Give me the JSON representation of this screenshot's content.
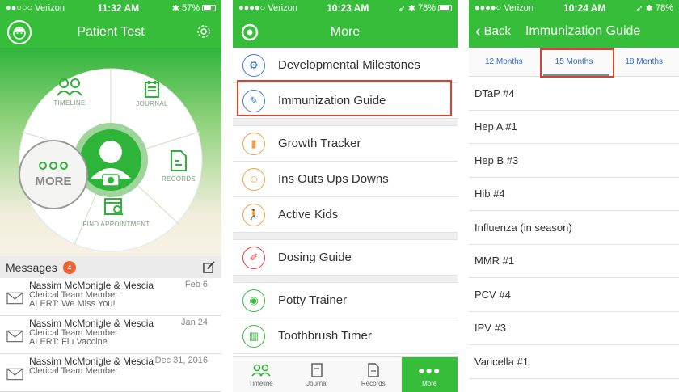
{
  "phone1": {
    "status": {
      "carrier": "●●○○○ Verizon",
      "time": "11:32 AM",
      "battery": "57%",
      "battery_level": 0.57
    },
    "title": "Patient Test",
    "wheel": {
      "timeline": "TIMELINE",
      "journal": "JOURNAL",
      "records": "RECORDS",
      "find_appointment": "FIND APPOINTMENT",
      "more": "MORE"
    },
    "messages": {
      "header": "Messages",
      "count": "4",
      "items": [
        {
          "from": "Nassim McMonigle & Mescia",
          "role": "Clerical Team Member",
          "subject": "ALERT: We Miss You!",
          "date": "Feb 6"
        },
        {
          "from": "Nassim McMonigle & Mescia",
          "role": "Clerical Team Member",
          "subject": "ALERT: Flu Vaccine",
          "date": "Jan 24"
        },
        {
          "from": "Nassim McMonigle & Mescia",
          "role": "Clerical Team Member",
          "subject": "",
          "date": "Dec 31, 2016"
        }
      ]
    }
  },
  "phone2": {
    "status": {
      "carrier": "●●●●○ Verizon",
      "time": "10:23 AM",
      "battery": "78%",
      "battery_level": 0.78
    },
    "title": "More",
    "menu": [
      {
        "label": "Developmental Milestones",
        "icon": "milestones-icon",
        "color": "#3a7fd5"
      },
      {
        "label": "Immunization Guide",
        "icon": "syringe-icon",
        "color": "#3a7fd5"
      },
      {
        "label": "Growth Tracker",
        "icon": "ruler-icon",
        "color": "#f0a146"
      },
      {
        "label": "Ins Outs Ups Downs",
        "icon": "baby-icon",
        "color": "#f0a146"
      },
      {
        "label": "Active Kids",
        "icon": "runner-icon",
        "color": "#f0a146"
      },
      {
        "label": "Dosing Guide",
        "icon": "dropper-icon",
        "color": "#e0413a"
      },
      {
        "label": "Potty Trainer",
        "icon": "potty-icon",
        "color": "#36bd3a"
      },
      {
        "label": "Toothbrush Timer",
        "icon": "toothbrush-icon",
        "color": "#36bd3a"
      }
    ],
    "tabbar": [
      {
        "label": "Timeline",
        "icon": "people-icon"
      },
      {
        "label": "Journal",
        "icon": "journal-icon"
      },
      {
        "label": "Records",
        "icon": "records-icon"
      },
      {
        "label": "More",
        "icon": "more-dots-icon"
      }
    ]
  },
  "phone3": {
    "status": {
      "carrier": "●●●●○ Verizon",
      "time": "10:24 AM",
      "battery": "78%",
      "battery_level": 0.78
    },
    "back": "Back",
    "title": "Immunization Guide",
    "tabs": [
      "12 Months",
      "15 Months",
      "18 Months"
    ],
    "selected_tab": "15 Months",
    "vaccines": [
      "DTaP #4",
      "Hep A #1",
      "Hep B #3",
      "Hib #4",
      "Influenza (in season)",
      "MMR #1",
      "PCV #4",
      "IPV #3",
      "Varicella #1"
    ]
  },
  "colors": {
    "brand_green": "#36bd3a",
    "highlight_red": "#d9432c",
    "badge_orange": "#f26334",
    "link_blue": "#2e6cc9"
  }
}
